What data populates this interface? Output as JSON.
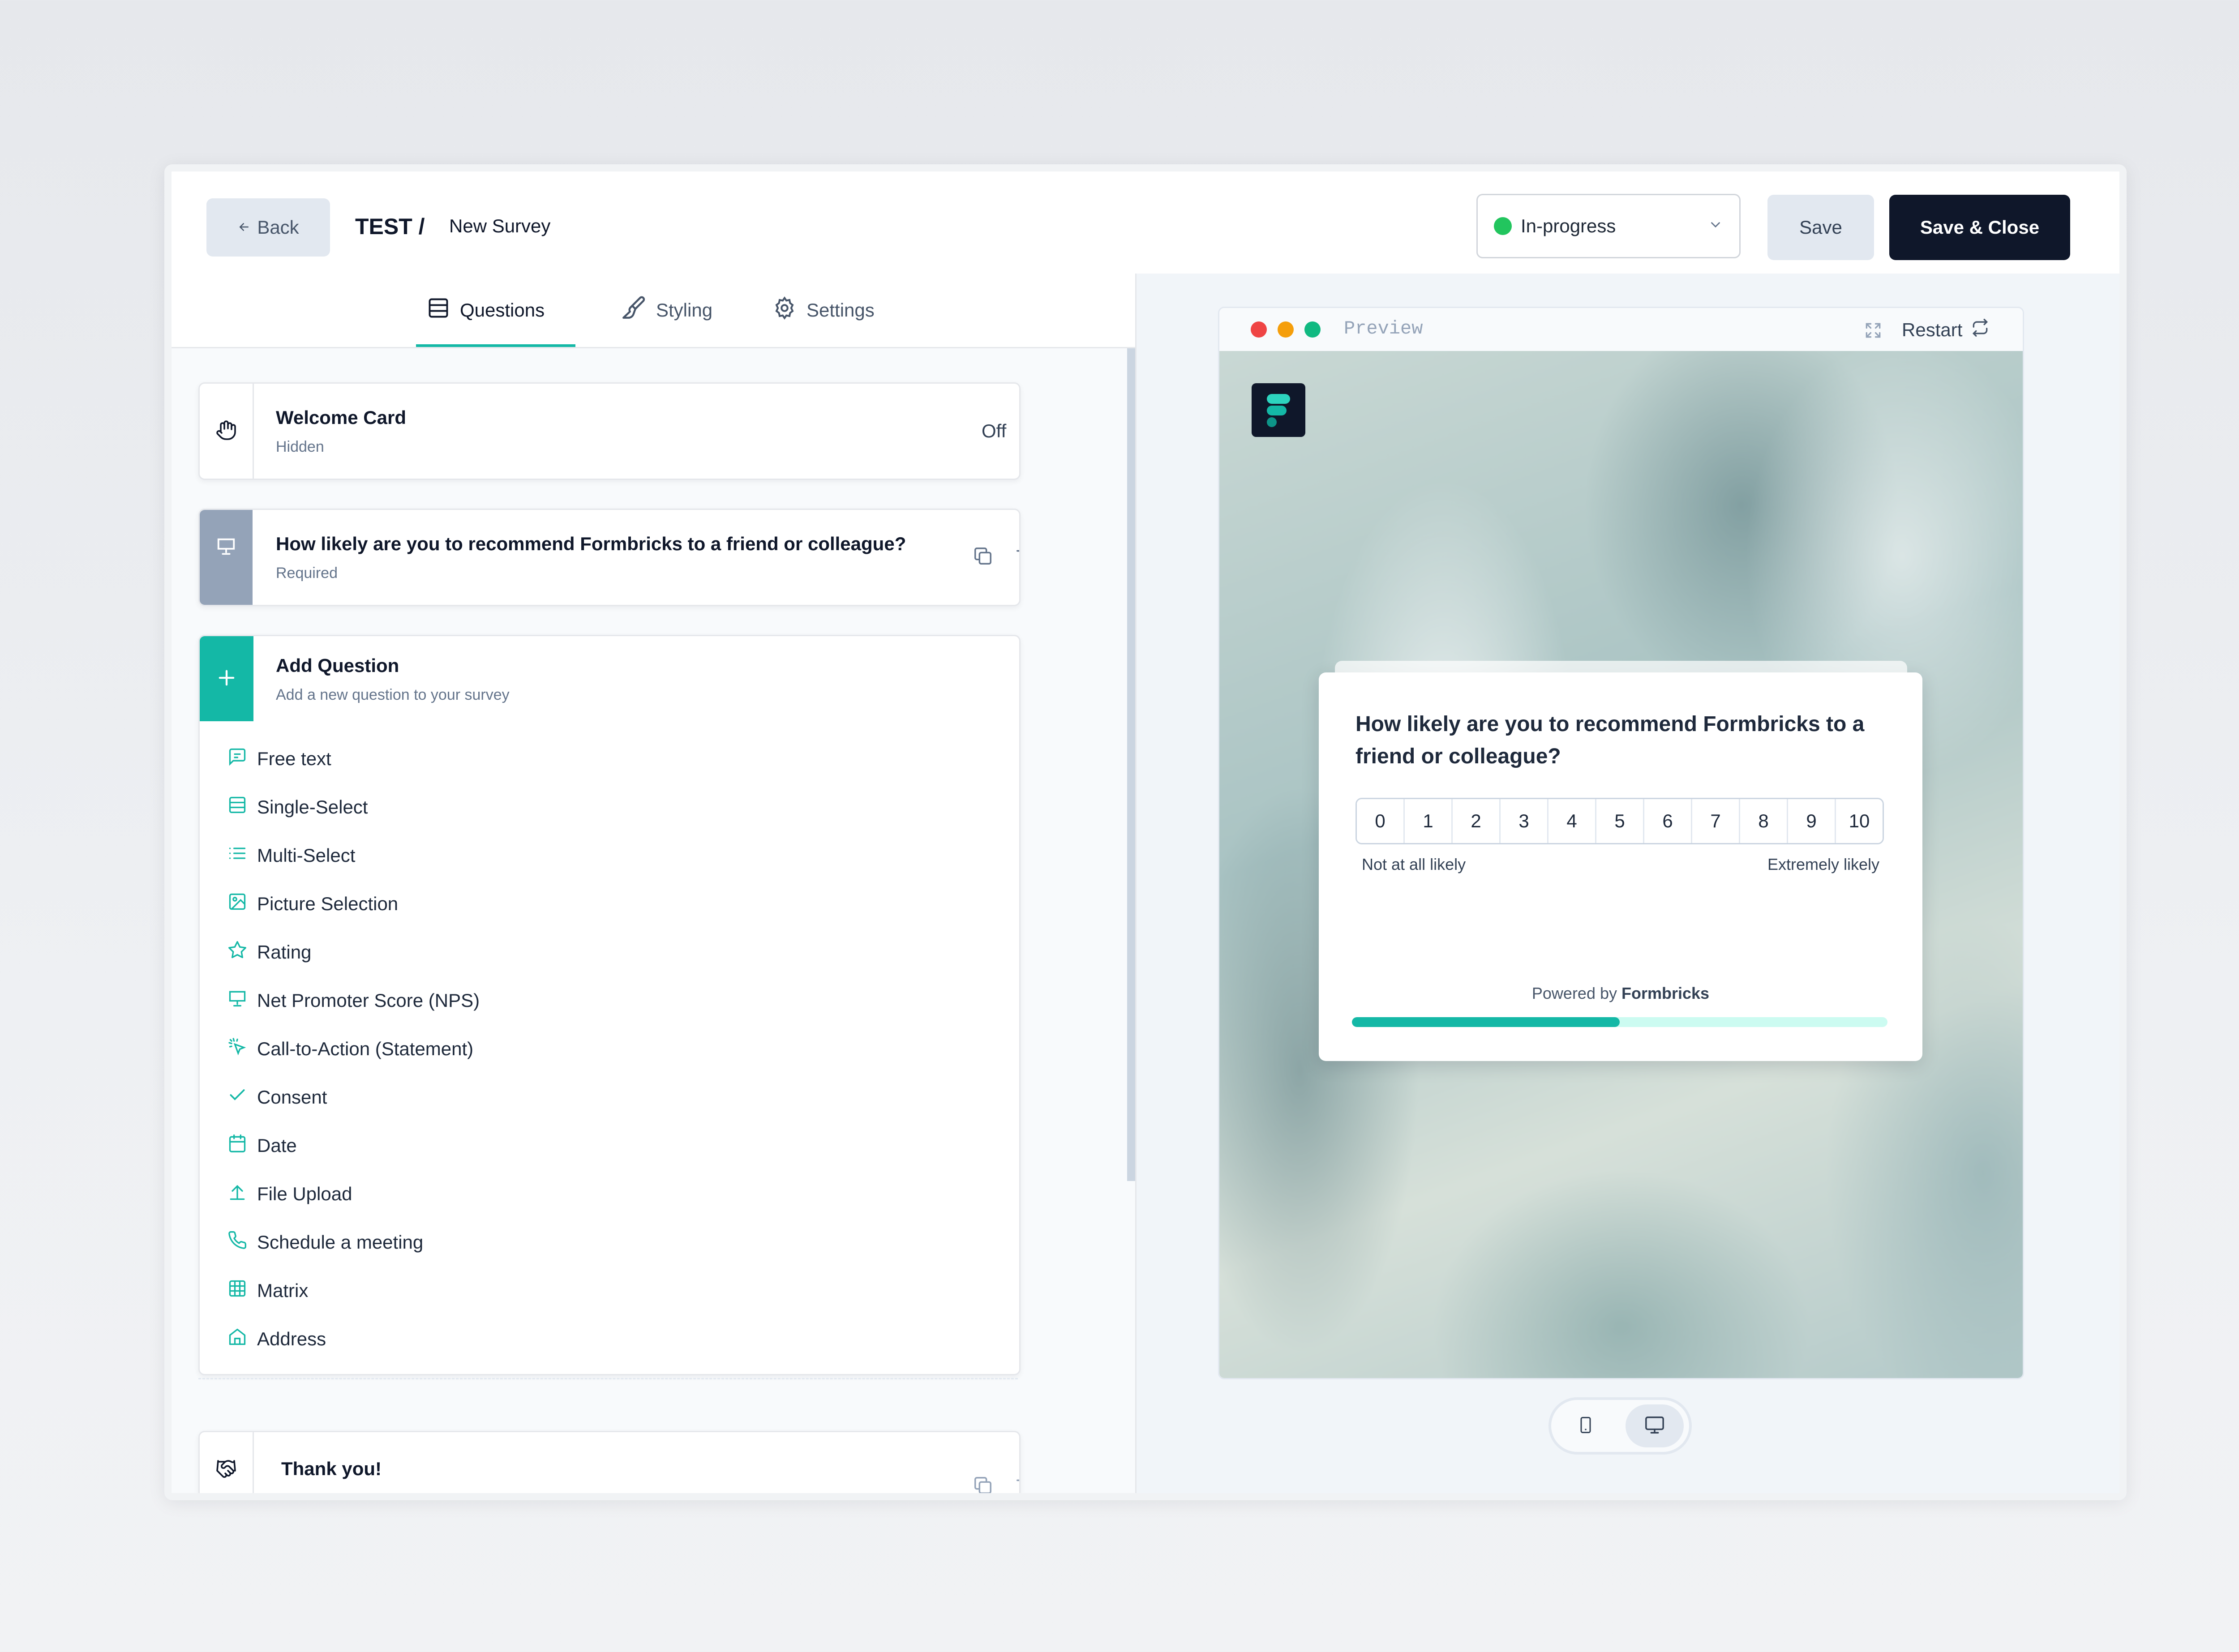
{
  "header": {
    "back_label": "Back",
    "breadcrumb_env": "TEST /",
    "survey_name": "New Survey",
    "status": "In-progress",
    "status_color": "#22c55e",
    "save_label": "Save",
    "save_close_label": "Save & Close"
  },
  "tabs": [
    {
      "label": "Questions",
      "icon": "list-icon",
      "active": true
    },
    {
      "label": "Styling",
      "icon": "paintbrush-icon",
      "active": false
    },
    {
      "label": "Settings",
      "icon": "gear-icon",
      "active": false
    }
  ],
  "welcome_card": {
    "title": "Welcome Card",
    "subtitle": "Hidden",
    "toggle_label": "Off",
    "enabled": false
  },
  "question_card": {
    "title": "How likely are you to recommend Formbricks to a friend or colleague?",
    "subtitle": "Required"
  },
  "add_question": {
    "title": "Add Question",
    "subtitle": "Add a new question to your survey",
    "types": [
      {
        "label": "Free text",
        "icon": "message-square-icon"
      },
      {
        "label": "Single-Select",
        "icon": "rows-icon"
      },
      {
        "label": "Multi-Select",
        "icon": "list-icon"
      },
      {
        "label": "Picture Selection",
        "icon": "image-icon"
      },
      {
        "label": "Rating",
        "icon": "star-icon"
      },
      {
        "label": "Net Promoter Score (NPS)",
        "icon": "presentation-icon"
      },
      {
        "label": "Call-to-Action (Statement)",
        "icon": "pointer-click-icon"
      },
      {
        "label": "Consent",
        "icon": "check-icon"
      },
      {
        "label": "Date",
        "icon": "calendar-icon"
      },
      {
        "label": "File Upload",
        "icon": "upload-icon"
      },
      {
        "label": "Schedule a meeting",
        "icon": "phone-icon"
      },
      {
        "label": "Matrix",
        "icon": "grid-icon"
      },
      {
        "label": "Address",
        "icon": "home-icon"
      }
    ]
  },
  "thank_you_card": {
    "title": "Thank you!"
  },
  "preview": {
    "window_title": "Preview",
    "restart_label": "Restart",
    "question": "How likely are you to recommend Formbricks to a friend or colleague?",
    "scale": [
      "0",
      "1",
      "2",
      "3",
      "4",
      "5",
      "6",
      "7",
      "8",
      "9",
      "10"
    ],
    "lower_label": "Not at all likely",
    "upper_label": "Extremely likely",
    "powered_prefix": "Powered by",
    "powered_brand": "Formbricks",
    "progress": 0.5,
    "device_mode": "desktop"
  },
  "colors": {
    "accent": "#14b8a6",
    "primary_dark": "#0f172a",
    "window_dot_red": "#ef4444",
    "window_dot_orange": "#f59e0b",
    "window_dot_green": "#10b981"
  }
}
